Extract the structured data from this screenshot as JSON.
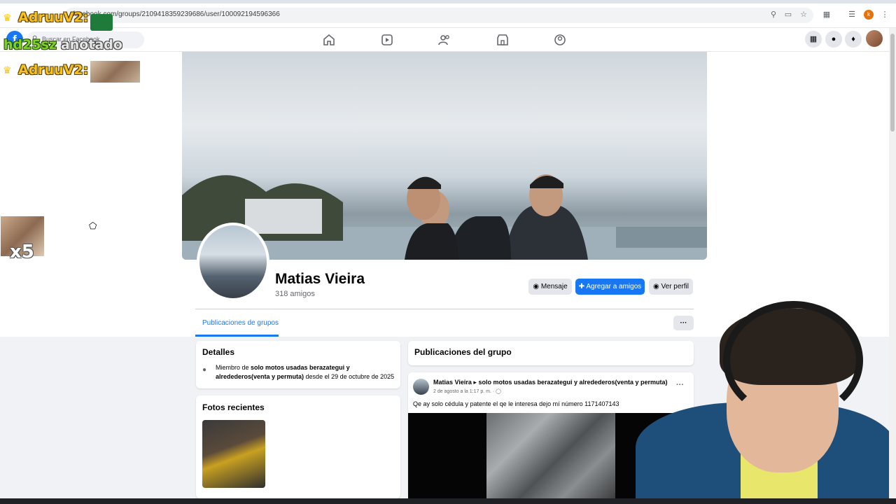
{
  "browser": {
    "url": "facebook.com/groups/2109418359239686/user/100092194596366",
    "profile_initial": "k"
  },
  "fb_header": {
    "logo": "f",
    "search_placeholder": "Buscar en Facebook"
  },
  "profile": {
    "name": "Matias Vieira",
    "friends": "318 amigos",
    "buttons": {
      "message": "Mensaje",
      "add_friend": "Agregar a amigos",
      "view_profile": "Ver perfil"
    },
    "tab_active": "Publicaciones de grupos",
    "more": "···"
  },
  "details": {
    "title": "Detalles",
    "text_prefix": "Miembro de ",
    "group_name": "solo motos usadas berazategui y alredederos(venta y permuta)",
    "text_suffix": " desde el 29 de octubre de 2025"
  },
  "photos": {
    "title": "Fotos recientes"
  },
  "group_posts": {
    "title": "Publicaciones del grupo",
    "post": {
      "author": "Matias Vieira",
      "arrow": "▸",
      "group": "solo motos usadas berazategui y alredederos(venta y permuta)",
      "meta": "2 de agosto a la 1:17 p. m. ·",
      "text": "Qe ay solo cédula y patente el qe le interesa dejo mí número 1171407143",
      "menu": "···"
    }
  },
  "overlay": {
    "name1": "AdruuV2:",
    "name2": "AdruuV2:",
    "user": "hd25sz",
    "status": "anotado",
    "multiplier": "x5"
  },
  "colors": {
    "fb_blue": "#1877f2",
    "overlay_gold": "#f7c21c",
    "overlay_green": "#7ed321"
  }
}
